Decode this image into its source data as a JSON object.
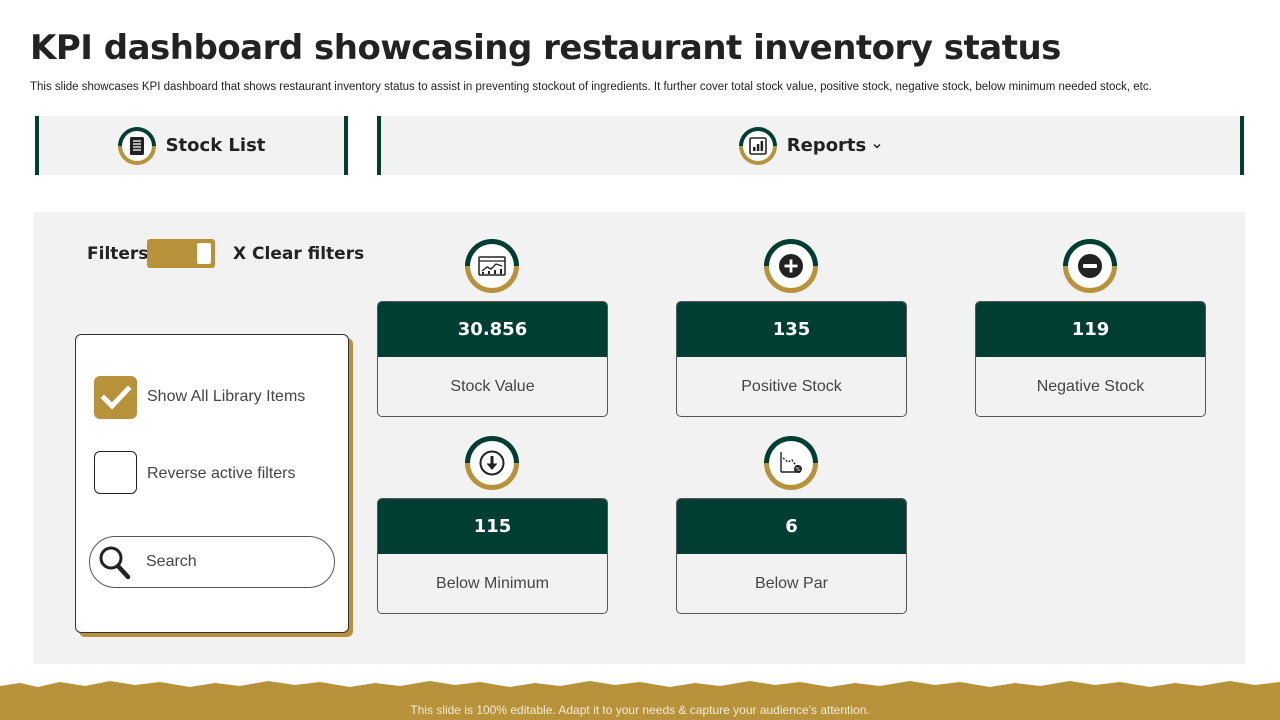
{
  "header": {
    "title": "KPI dashboard showcasing restaurant inventory status",
    "subtitle": "This slide showcases KPI dashboard that shows restaurant inventory status to assist in preventing stockout of ingredients. It further cover total stock value, positive stock, negative stock, below minimum needed stock, etc."
  },
  "nav": {
    "stock_list": "Stock List",
    "reports": "Reports"
  },
  "filters": {
    "label": "Filters",
    "toggle_on": true,
    "clear": "X Clear filters",
    "show_all": "Show All Library Items",
    "show_all_checked": true,
    "reverse": "Reverse active filters",
    "reverse_checked": false,
    "search_placeholder": "Search"
  },
  "kpis": [
    {
      "value": "30.856",
      "label": "Stock Value",
      "icon": "stock-chart-icon"
    },
    {
      "value": "135",
      "label": "Positive Stock",
      "icon": "plus-circle-icon"
    },
    {
      "value": "119",
      "label": "Negative Stock",
      "icon": "minus-circle-icon"
    },
    {
      "value": "115",
      "label": "Below Minimum",
      "icon": "down-arrow-circle-icon"
    },
    {
      "value": "6",
      "label": "Below Par",
      "icon": "declining-chart-icon"
    }
  ],
  "footer": {
    "text": "This slide is 100% editable. Adapt it to your needs & capture your audience’s attention."
  },
  "colors": {
    "dark_green": "#003d33",
    "gold": "#b8923a",
    "panel_gray": "#f2f2f2"
  }
}
